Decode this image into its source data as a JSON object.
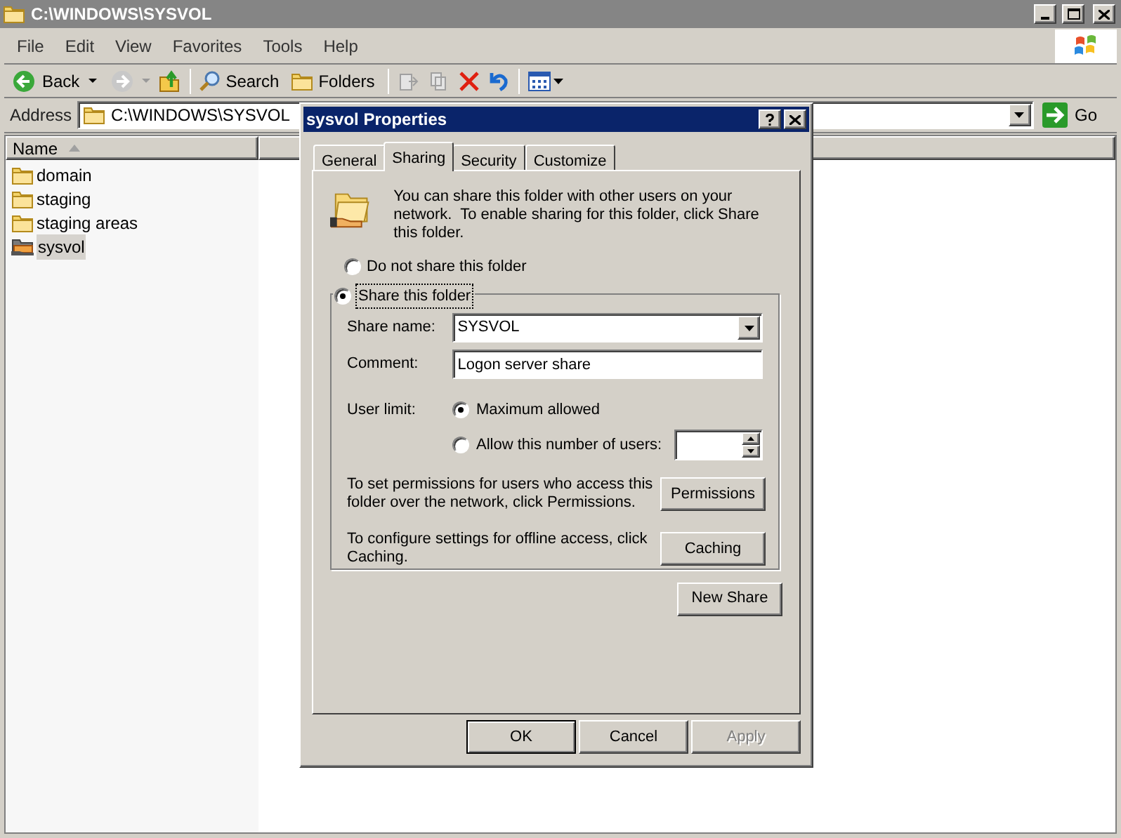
{
  "window": {
    "title": "C:\\WINDOWS\\SYSVOL"
  },
  "menu": [
    "File",
    "Edit",
    "View",
    "Favorites",
    "Tools",
    "Help"
  ],
  "toolbar": {
    "back": "Back",
    "search": "Search",
    "folders": "Folders"
  },
  "address": {
    "label": "Address",
    "value": "C:\\WINDOWS\\SYSVOL",
    "go": "Go"
  },
  "columns": [
    {
      "label": "Name"
    }
  ],
  "files": [
    {
      "name": "domain",
      "kind": "folder",
      "selected": false
    },
    {
      "name": "staging",
      "kind": "folder",
      "selected": false
    },
    {
      "name": "staging areas",
      "kind": "folder",
      "selected": false
    },
    {
      "name": "sysvol",
      "kind": "shared",
      "selected": true
    }
  ],
  "dialog": {
    "title": "sysvol Properties",
    "tabs": [
      {
        "label": "General",
        "selected": false
      },
      {
        "label": "Sharing",
        "selected": true
      },
      {
        "label": "Security",
        "selected": false
      },
      {
        "label": "Customize",
        "selected": false
      }
    ],
    "intro": "You can share this folder with other users on your network.  To enable sharing for this folder, click Share this folder.",
    "share_options": [
      {
        "label": "Do not share this folder",
        "selected": false
      },
      {
        "label": "Share this folder",
        "selected": true
      }
    ],
    "share_name_label": "Share name:",
    "share_name": "SYSVOL",
    "comment_label": "Comment:",
    "comment": "Logon server share",
    "user_limit_label": "User limit:",
    "user_limit_options": [
      {
        "label": "Maximum allowed",
        "selected": true
      },
      {
        "label": "Allow this number of users:",
        "selected": false
      }
    ],
    "permissions_text": "To set permissions for users who access this folder over the network, click Permissions.",
    "permissions_button": "Permissions",
    "caching_text": "To configure settings for offline access, click Caching.",
    "caching_button": "Caching",
    "new_share_button": "New Share",
    "buttons": [
      {
        "label": "OK",
        "default": true,
        "disabled": false
      },
      {
        "label": "Cancel",
        "default": false,
        "disabled": false
      },
      {
        "label": "Apply",
        "default": false,
        "disabled": true
      }
    ]
  }
}
